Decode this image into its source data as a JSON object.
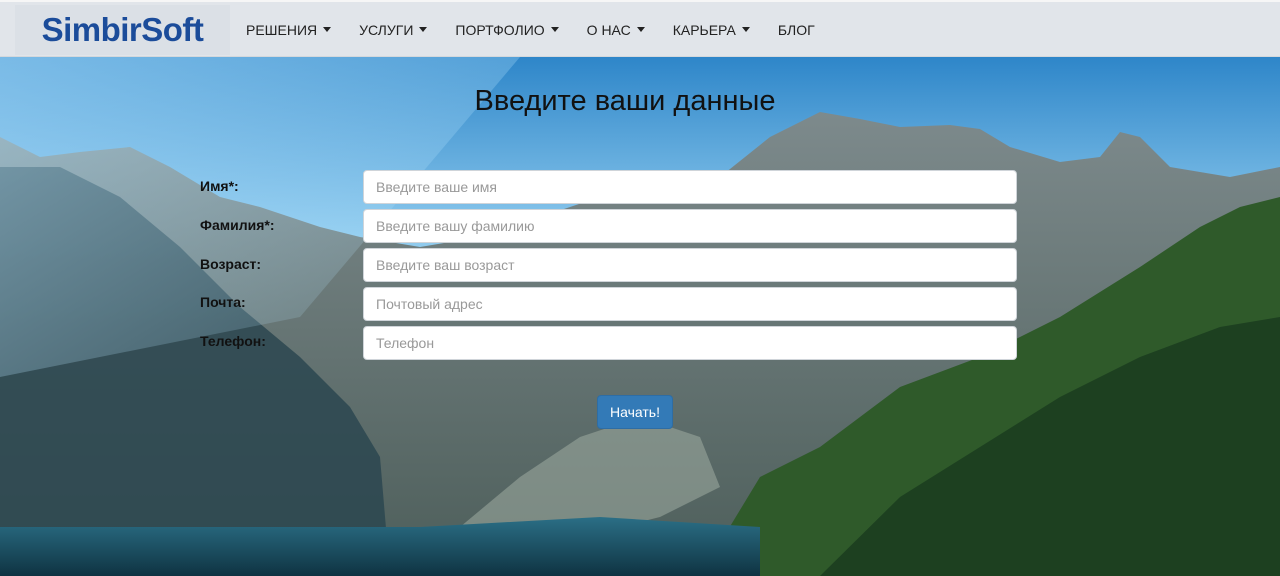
{
  "brand": {
    "logo_text": "SimbirSoft"
  },
  "nav": {
    "items": [
      {
        "label": "РЕШЕНИЯ",
        "has_dropdown": true
      },
      {
        "label": "УСЛУГИ",
        "has_dropdown": true
      },
      {
        "label": "ПОРТФОЛИО",
        "has_dropdown": true
      },
      {
        "label": "О НАС",
        "has_dropdown": true
      },
      {
        "label": "КАРЬЕРА",
        "has_dropdown": true
      },
      {
        "label": "БЛОГ",
        "has_dropdown": false
      }
    ]
  },
  "form": {
    "title": "Введите ваши данные",
    "fields": [
      {
        "label": "Имя*:",
        "placeholder": "Введите ваше имя",
        "value": ""
      },
      {
        "label": "Фамилия*:",
        "placeholder": "Введите вашу фамилию",
        "value": ""
      },
      {
        "label": "Возраст:",
        "placeholder": "Введите ваш возраст",
        "value": ""
      },
      {
        "label": "Почта:",
        "placeholder": "Почтовый адрес",
        "value": ""
      },
      {
        "label": "Телефон:",
        "placeholder": "Телефон",
        "value": ""
      }
    ],
    "submit_label": "Начать!"
  },
  "colors": {
    "brand": "#1b4c9a",
    "navbar_bg": "#e1e5ea",
    "button_primary": "#337ab7"
  }
}
